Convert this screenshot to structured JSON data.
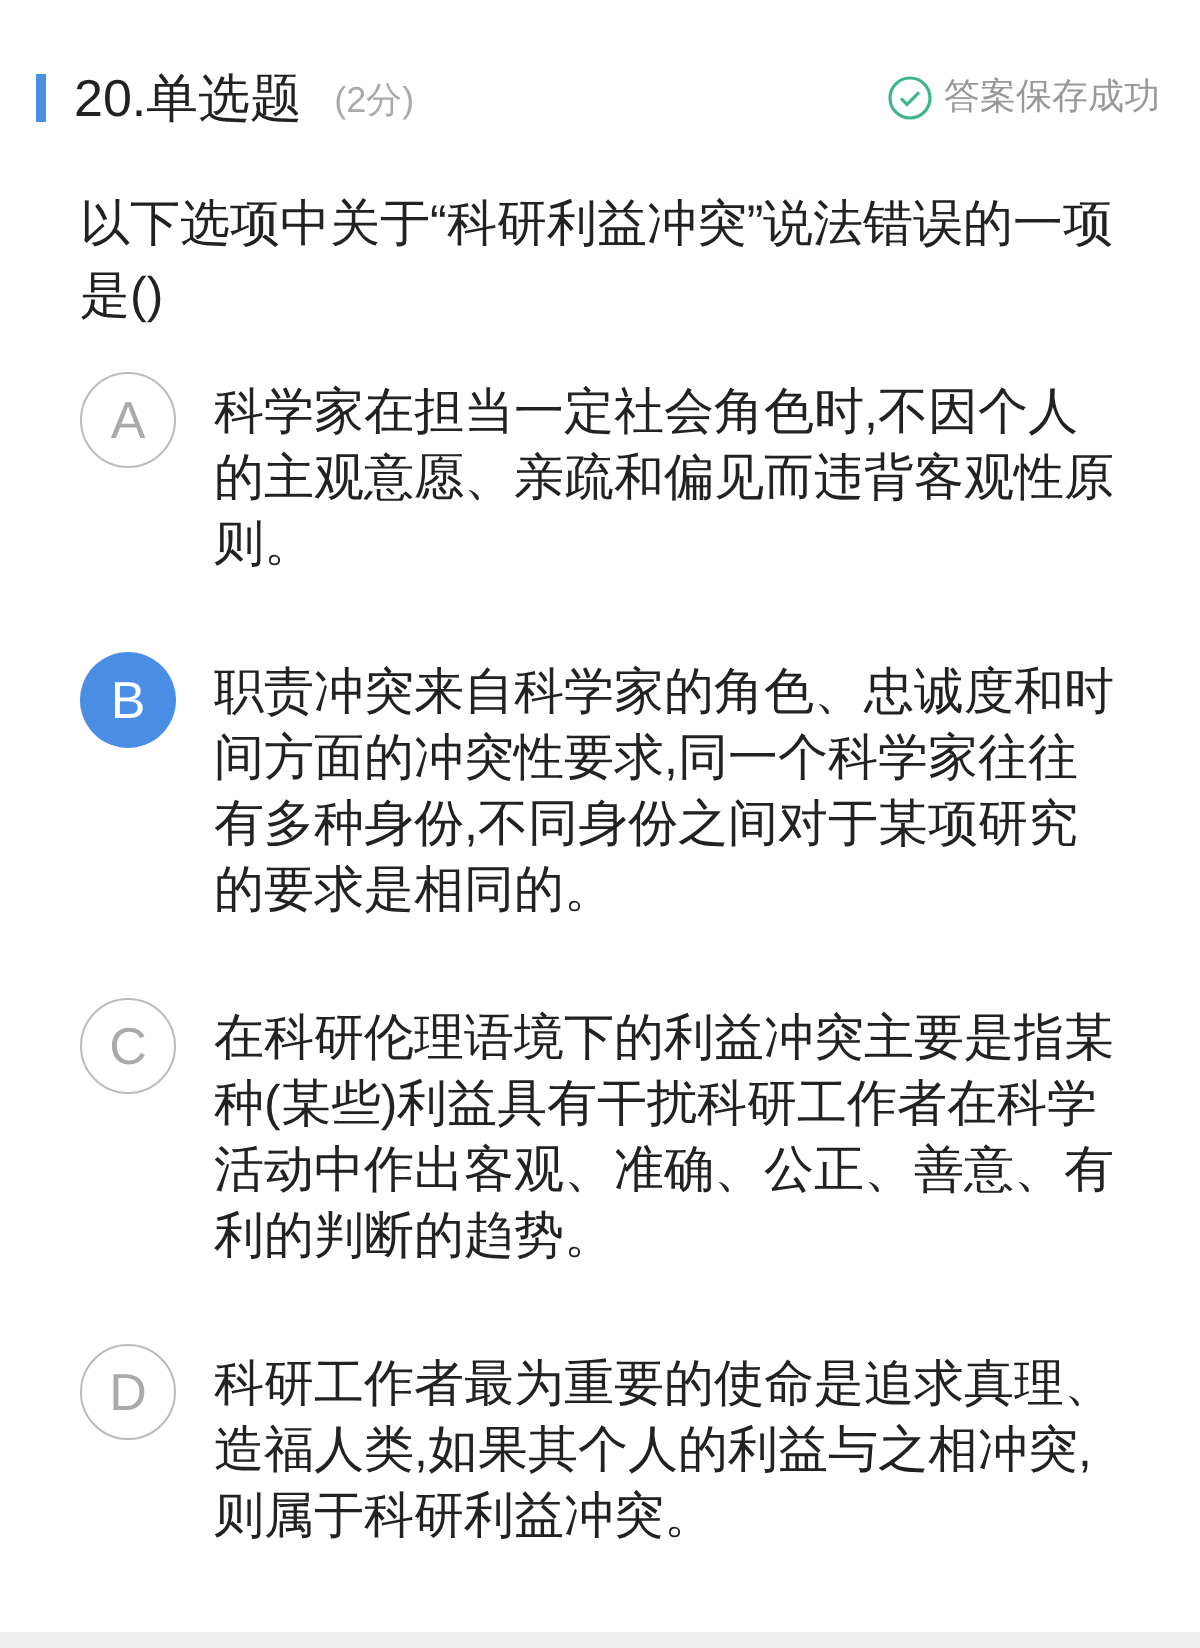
{
  "header": {
    "title": "20.单选题",
    "score": "(2分)",
    "save_status": "答案保存成功"
  },
  "question": "以下选项中关于“科研利益冲突”说法错误的一项是()",
  "options": [
    {
      "letter": "A",
      "text": "科学家在担当一定社会角色时,不因个人的主观意愿、亲疏和偏见而违背客观性原则。",
      "selected": false
    },
    {
      "letter": "B",
      "text": "职责冲突来自科学家的角色、忠诚度和时间方面的冲突性要求,同一个科学家往往有多种身份,不同身份之间对于某项研究的要求是相同的。",
      "selected": true
    },
    {
      "letter": "C",
      "text": "在科研伦理语境下的利益冲突主要是指某种(某些)利益具有干扰科研工作者在科学活动中作出客观、准确、公正、善意、有利的判断的趋势。",
      "selected": false
    },
    {
      "letter": "D",
      "text": "科研工作者最为重要的使命是追求真理、造福人类,如果其个人的利益与之相冲突,则属于科研利益冲突。",
      "selected": false
    }
  ]
}
